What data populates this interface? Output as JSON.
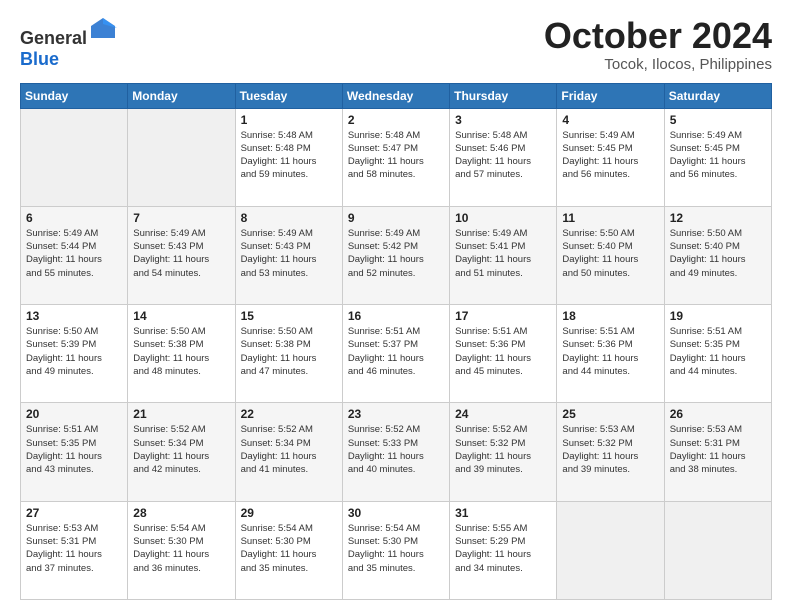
{
  "header": {
    "logo_general": "General",
    "logo_blue": "Blue",
    "title": "October 2024",
    "location": "Tocok, Ilocos, Philippines"
  },
  "calendar": {
    "headers": [
      "Sunday",
      "Monday",
      "Tuesday",
      "Wednesday",
      "Thursday",
      "Friday",
      "Saturday"
    ],
    "rows": [
      [
        {
          "num": "",
          "detail": "",
          "empty": true
        },
        {
          "num": "",
          "detail": "",
          "empty": true
        },
        {
          "num": "1",
          "detail": "Sunrise: 5:48 AM\nSunset: 5:48 PM\nDaylight: 11 hours\nand 59 minutes.",
          "empty": false
        },
        {
          "num": "2",
          "detail": "Sunrise: 5:48 AM\nSunset: 5:47 PM\nDaylight: 11 hours\nand 58 minutes.",
          "empty": false
        },
        {
          "num": "3",
          "detail": "Sunrise: 5:48 AM\nSunset: 5:46 PM\nDaylight: 11 hours\nand 57 minutes.",
          "empty": false
        },
        {
          "num": "4",
          "detail": "Sunrise: 5:49 AM\nSunset: 5:45 PM\nDaylight: 11 hours\nand 56 minutes.",
          "empty": false
        },
        {
          "num": "5",
          "detail": "Sunrise: 5:49 AM\nSunset: 5:45 PM\nDaylight: 11 hours\nand 56 minutes.",
          "empty": false
        }
      ],
      [
        {
          "num": "6",
          "detail": "Sunrise: 5:49 AM\nSunset: 5:44 PM\nDaylight: 11 hours\nand 55 minutes.",
          "empty": false
        },
        {
          "num": "7",
          "detail": "Sunrise: 5:49 AM\nSunset: 5:43 PM\nDaylight: 11 hours\nand 54 minutes.",
          "empty": false
        },
        {
          "num": "8",
          "detail": "Sunrise: 5:49 AM\nSunset: 5:43 PM\nDaylight: 11 hours\nand 53 minutes.",
          "empty": false
        },
        {
          "num": "9",
          "detail": "Sunrise: 5:49 AM\nSunset: 5:42 PM\nDaylight: 11 hours\nand 52 minutes.",
          "empty": false
        },
        {
          "num": "10",
          "detail": "Sunrise: 5:49 AM\nSunset: 5:41 PM\nDaylight: 11 hours\nand 51 minutes.",
          "empty": false
        },
        {
          "num": "11",
          "detail": "Sunrise: 5:50 AM\nSunset: 5:40 PM\nDaylight: 11 hours\nand 50 minutes.",
          "empty": false
        },
        {
          "num": "12",
          "detail": "Sunrise: 5:50 AM\nSunset: 5:40 PM\nDaylight: 11 hours\nand 49 minutes.",
          "empty": false
        }
      ],
      [
        {
          "num": "13",
          "detail": "Sunrise: 5:50 AM\nSunset: 5:39 PM\nDaylight: 11 hours\nand 49 minutes.",
          "empty": false
        },
        {
          "num": "14",
          "detail": "Sunrise: 5:50 AM\nSunset: 5:38 PM\nDaylight: 11 hours\nand 48 minutes.",
          "empty": false
        },
        {
          "num": "15",
          "detail": "Sunrise: 5:50 AM\nSunset: 5:38 PM\nDaylight: 11 hours\nand 47 minutes.",
          "empty": false
        },
        {
          "num": "16",
          "detail": "Sunrise: 5:51 AM\nSunset: 5:37 PM\nDaylight: 11 hours\nand 46 minutes.",
          "empty": false
        },
        {
          "num": "17",
          "detail": "Sunrise: 5:51 AM\nSunset: 5:36 PM\nDaylight: 11 hours\nand 45 minutes.",
          "empty": false
        },
        {
          "num": "18",
          "detail": "Sunrise: 5:51 AM\nSunset: 5:36 PM\nDaylight: 11 hours\nand 44 minutes.",
          "empty": false
        },
        {
          "num": "19",
          "detail": "Sunrise: 5:51 AM\nSunset: 5:35 PM\nDaylight: 11 hours\nand 44 minutes.",
          "empty": false
        }
      ],
      [
        {
          "num": "20",
          "detail": "Sunrise: 5:51 AM\nSunset: 5:35 PM\nDaylight: 11 hours\nand 43 minutes.",
          "empty": false
        },
        {
          "num": "21",
          "detail": "Sunrise: 5:52 AM\nSunset: 5:34 PM\nDaylight: 11 hours\nand 42 minutes.",
          "empty": false
        },
        {
          "num": "22",
          "detail": "Sunrise: 5:52 AM\nSunset: 5:34 PM\nDaylight: 11 hours\nand 41 minutes.",
          "empty": false
        },
        {
          "num": "23",
          "detail": "Sunrise: 5:52 AM\nSunset: 5:33 PM\nDaylight: 11 hours\nand 40 minutes.",
          "empty": false
        },
        {
          "num": "24",
          "detail": "Sunrise: 5:52 AM\nSunset: 5:32 PM\nDaylight: 11 hours\nand 39 minutes.",
          "empty": false
        },
        {
          "num": "25",
          "detail": "Sunrise: 5:53 AM\nSunset: 5:32 PM\nDaylight: 11 hours\nand 39 minutes.",
          "empty": false
        },
        {
          "num": "26",
          "detail": "Sunrise: 5:53 AM\nSunset: 5:31 PM\nDaylight: 11 hours\nand 38 minutes.",
          "empty": false
        }
      ],
      [
        {
          "num": "27",
          "detail": "Sunrise: 5:53 AM\nSunset: 5:31 PM\nDaylight: 11 hours\nand 37 minutes.",
          "empty": false
        },
        {
          "num": "28",
          "detail": "Sunrise: 5:54 AM\nSunset: 5:30 PM\nDaylight: 11 hours\nand 36 minutes.",
          "empty": false
        },
        {
          "num": "29",
          "detail": "Sunrise: 5:54 AM\nSunset: 5:30 PM\nDaylight: 11 hours\nand 35 minutes.",
          "empty": false
        },
        {
          "num": "30",
          "detail": "Sunrise: 5:54 AM\nSunset: 5:30 PM\nDaylight: 11 hours\nand 35 minutes.",
          "empty": false
        },
        {
          "num": "31",
          "detail": "Sunrise: 5:55 AM\nSunset: 5:29 PM\nDaylight: 11 hours\nand 34 minutes.",
          "empty": false
        },
        {
          "num": "",
          "detail": "",
          "empty": true
        },
        {
          "num": "",
          "detail": "",
          "empty": true
        }
      ]
    ]
  }
}
